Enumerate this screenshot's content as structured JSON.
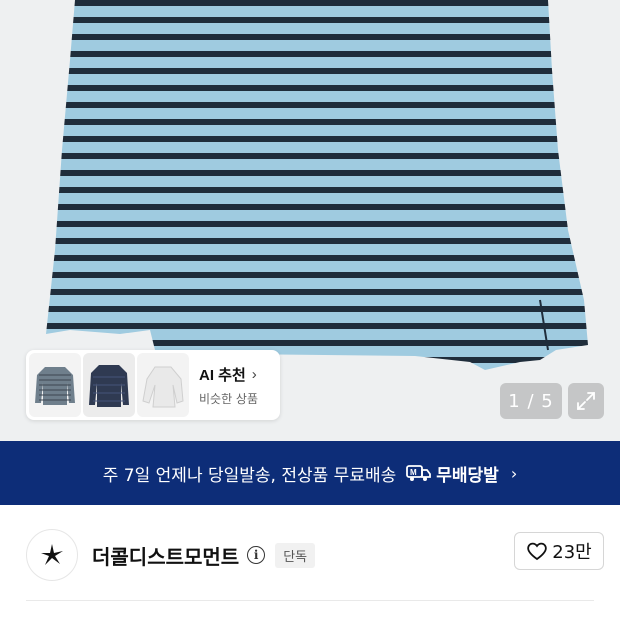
{
  "hero": {
    "reco_title": "AI 추천",
    "reco_subtitle": "비슷한 상품",
    "pager_text": "1 / 5",
    "stripe_colors": [
      "#9fcbe0",
      "#1f2d3b"
    ]
  },
  "banner": {
    "text": "주 7일 언제나 당일발송, 전상품 무료배송",
    "free_label": "무배당발",
    "background": "#0d2d78"
  },
  "seller": {
    "name": "더콜디스트모먼트",
    "badge": "단독",
    "likes": "23만"
  },
  "icons": {
    "expand": "expand-icon",
    "info": "info-icon",
    "heart": "heart-icon",
    "chevron": "chevron-right-icon"
  }
}
